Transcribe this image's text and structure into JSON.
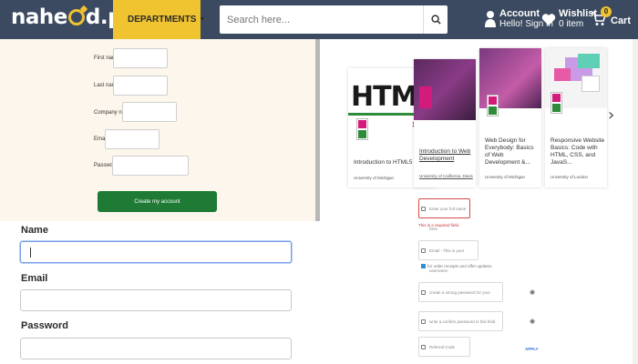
{
  "header": {
    "logo": "nahe d.pk",
    "logo_pre": "nahe",
    "logo_post": "d.pk",
    "departments_label": "DEPARTMENTS",
    "search_placeholder": "Search here...",
    "account_title": "Account",
    "account_sub": "Hello! Sign in",
    "wishlist_title": "Wishlist",
    "wishlist_sub": "0 item",
    "cart_label": "Cart",
    "cart_count": "0",
    "colors": {
      "bar": "#3b4a60",
      "accent": "#f0c331"
    }
  },
  "signup_top": {
    "first_name": "First name",
    "last_name": "Last name",
    "company_name": "Company name",
    "email": "Email",
    "password": "Password",
    "create_button": "Create my account"
  },
  "signup_bottom": {
    "name_label": "Name",
    "email_label": "Email",
    "password_label": "Password"
  },
  "courses": [
    {
      "title": "Introduction to HTML5",
      "sub": "University of Michigan",
      "thumb_text": "HTML"
    },
    {
      "title": "Introduction to Web Development",
      "sub": "University of California, Davis"
    },
    {
      "title": "Web Design for Everybody: Basics of Web Development &...",
      "sub": "University of Michigan"
    },
    {
      "title": "Responsive Website Basics: Code with HTML, CSS, and JavaS...",
      "sub": "University of London"
    }
  ],
  "right_form": {
    "name_placeholder": "Enter your full name here",
    "required_error": "This is a required field.",
    "email_placeholder": "Email - This is your username",
    "email_note": "for order receipts and offer updates.",
    "password_placeholder": "create a strong password for your security",
    "confirm_placeholder": "write a confirm password in this field",
    "referral_placeholder": "Referral Code",
    "apply_label": "APPLY"
  }
}
